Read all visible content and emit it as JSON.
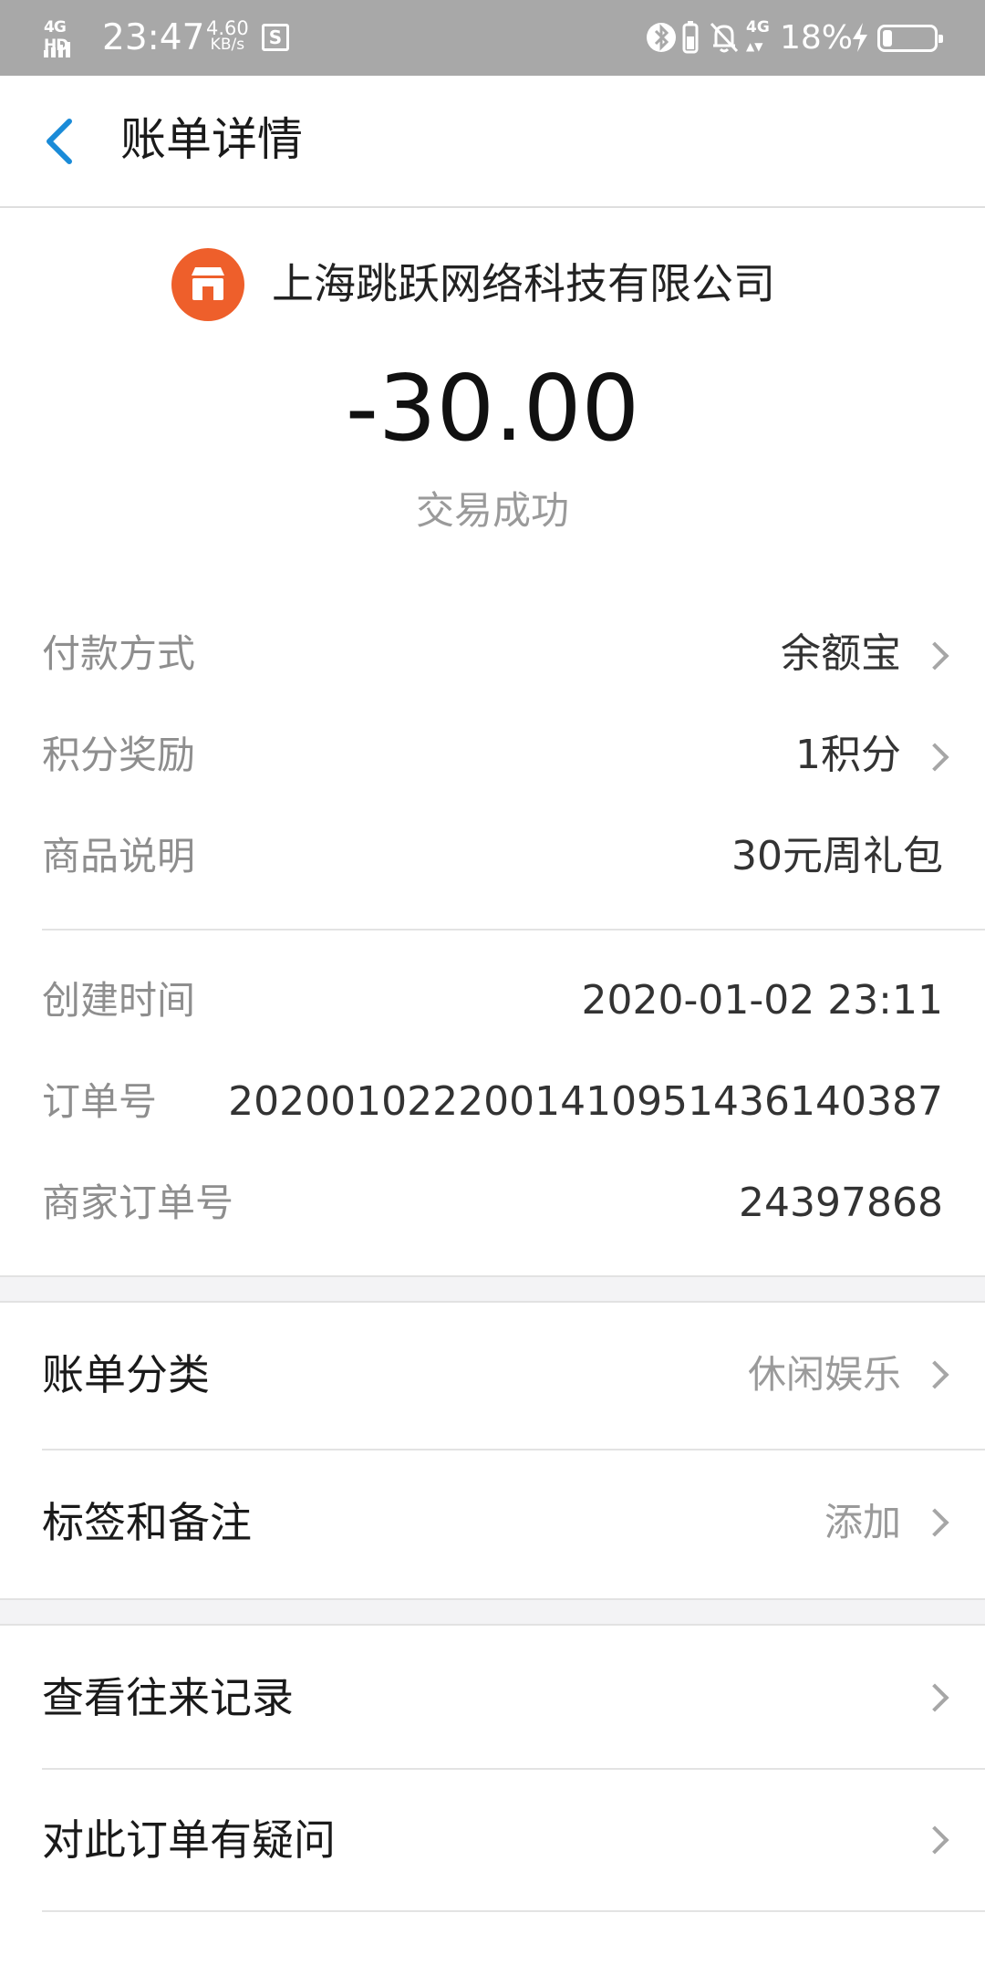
{
  "status_bar": {
    "network": "4G HD",
    "time": "23:47",
    "speed_value": "4.60",
    "speed_unit": "KB/s",
    "mobile_data": "4G",
    "battery_percent": "18%",
    "battery_level": 0.18,
    "icons": [
      "signal-icon",
      "screenshot-icon",
      "bluetooth-icon",
      "battery-small-icon",
      "mute-icon",
      "charging-icon",
      "battery-icon"
    ]
  },
  "nav": {
    "title": "账单详情",
    "back_icon": "chevron-left-icon"
  },
  "header": {
    "merchant_name": "上海跳跃网络科技有限公司",
    "logo_icon": "store-icon",
    "amount": "-30.00",
    "status": "交易成功"
  },
  "details_group1": [
    {
      "label": "付款方式",
      "value": "余额宝"
    },
    {
      "label": "积分奖励",
      "value": "1积分"
    },
    {
      "label": "商品说明",
      "value": "30元周礼包"
    }
  ],
  "details_group2": [
    {
      "label": "创建时间",
      "value": "2020-01-02 23:11"
    },
    {
      "label": "订单号",
      "value": "20200102220014109514361​40387"
    },
    {
      "label": "商家订单号",
      "value": "24397868"
    }
  ],
  "actions_group1": [
    {
      "label": "账单分类",
      "value": "休闲娱乐"
    },
    {
      "label": "标签和备注",
      "value": "添加"
    }
  ],
  "actions_group2": [
    {
      "label": "查看往来记录"
    },
    {
      "label": "对此订单有疑问"
    }
  ],
  "colors": {
    "accent_blue": "#1a8bd8",
    "merchant_orange": "#ee5f2b",
    "status_bar": "#a8a8a8"
  }
}
